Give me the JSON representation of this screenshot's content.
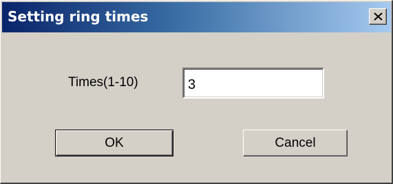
{
  "window": {
    "title": "Setting ring times",
    "close_icon": "close-icon"
  },
  "form": {
    "label": "Times(1-10)",
    "value": "3"
  },
  "buttons": {
    "ok_label": "OK",
    "cancel_label": "Cancel"
  },
  "colors": {
    "titlebar_start": "#0a246a",
    "titlebar_end": "#a6caf0",
    "dialog_background": "#d4d0c8"
  }
}
